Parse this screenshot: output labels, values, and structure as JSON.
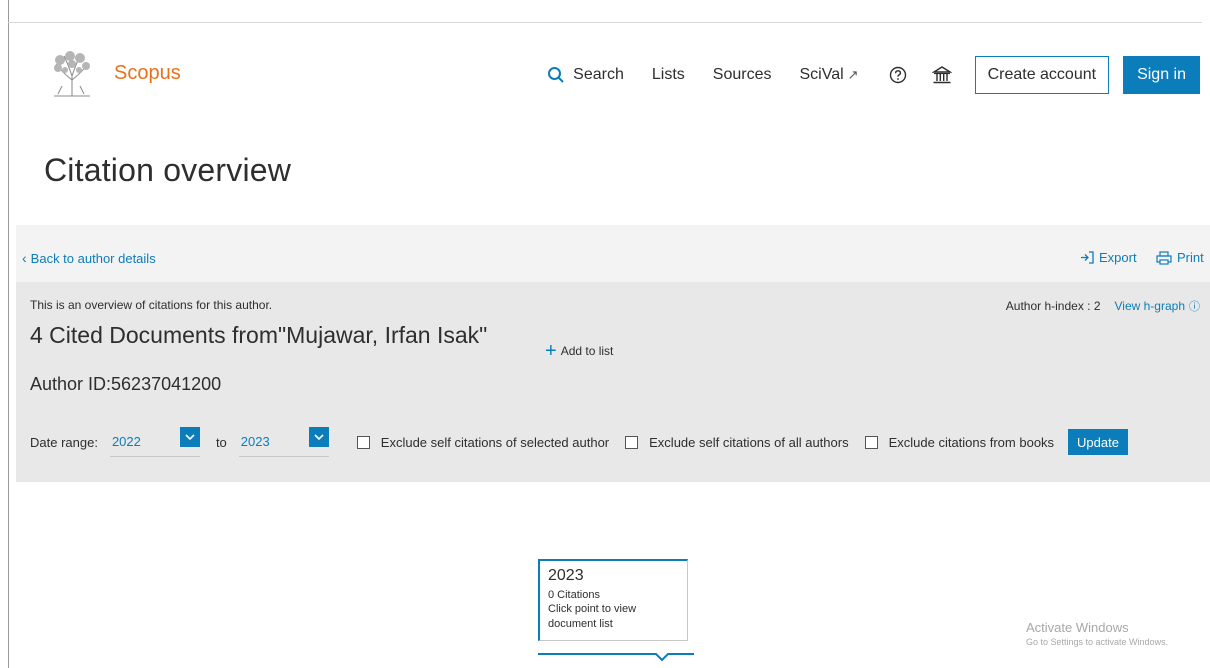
{
  "header": {
    "brand": "Scopus",
    "nav": {
      "search": "Search",
      "lists": "Lists",
      "sources": "Sources",
      "scival": "SciVal"
    },
    "icons": {
      "search": "search-icon",
      "scival": "external-link-icon",
      "help": "help-circle-icon",
      "institution": "institution-icon"
    },
    "create_account": "Create account",
    "sign_in": "Sign in"
  },
  "page": {
    "title": "Citation overview"
  },
  "toolbar": {
    "back": "Back to author details",
    "export": "Export",
    "print": "Print"
  },
  "overview": {
    "intro": "This is an overview of citations for this author.",
    "hindex_label": "Author h-index : 2",
    "view_hgraph": "View h-graph",
    "cited_title": "4 Cited Documents from\"Mujawar, Irfan Isak\"",
    "add_to_list": "Add to list",
    "author_id": "Author ID:56237041200"
  },
  "filters": {
    "date_range_label": "Date range:",
    "from_year": "2022",
    "to_label": "to",
    "to_year": "2023",
    "exclude_self_selected": "Exclude self citations of selected author",
    "exclude_self_all": "Exclude self citations of all authors",
    "exclude_books": "Exclude citations from books",
    "update": "Update"
  },
  "tooltip": {
    "year": "2023",
    "citations": "0 Citations",
    "hint": "Click point to view document list"
  },
  "watermark": {
    "line1": "Activate Windows",
    "line2": "Go to Settings to activate Windows."
  },
  "colors": {
    "accent": "#0c7dbb",
    "brand": "#e9711c",
    "panel_light": "#f3f3f3",
    "panel_dark": "#e8e8e8"
  }
}
